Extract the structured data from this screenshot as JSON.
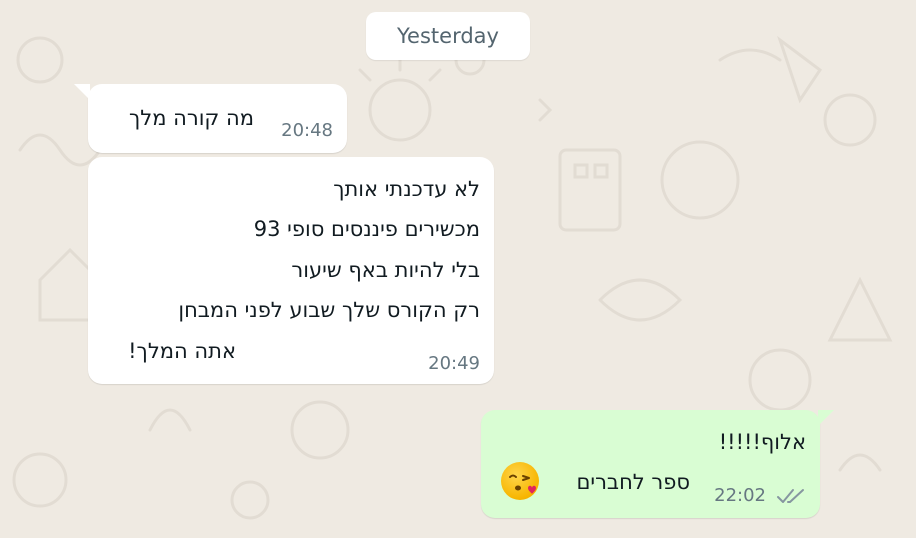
{
  "chat": {
    "date_separator": "Yesterday",
    "messages": [
      {
        "direction": "incoming",
        "lines": [
          "מה קורה מלך"
        ],
        "time": "20:48"
      },
      {
        "direction": "incoming",
        "lines": [
          "לא עדכנתי אותך",
          "מכשירים פיננסים סופי 93",
          "בלי להיות באף שיעור",
          "רק הקורס שלך שבוע לפני המבחן",
          "אתה המלך!"
        ],
        "time": "20:49"
      },
      {
        "direction": "outgoing",
        "lines": [
          "אלוף!!!!!",
          "ספר לחברים"
        ],
        "emoji": "face-blowing-kiss-emoji",
        "time": "22:02",
        "status": "read-double-check"
      }
    ]
  },
  "colors": {
    "background": "#efeae2",
    "incoming_bubble": "#ffffff",
    "outgoing_bubble": "#d9fdd3",
    "timestamp": "#667781",
    "read_checks": "#8696a0"
  }
}
